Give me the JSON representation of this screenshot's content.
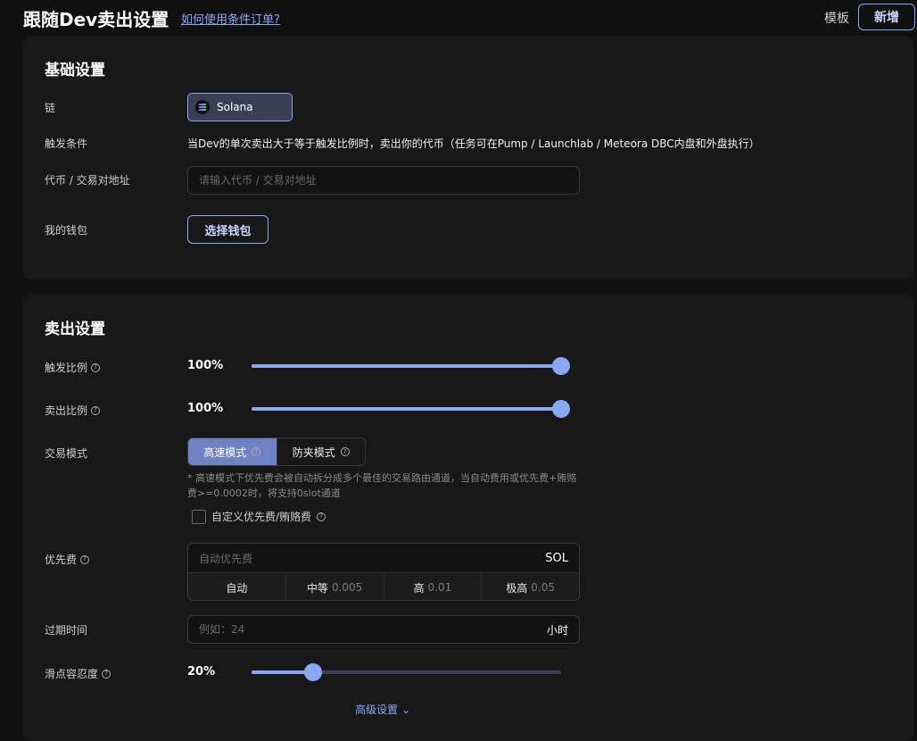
{
  "header": {
    "title": "跟随Dev卖出设置",
    "help_link": "如何使用条件订单?",
    "template_label": "模板",
    "add_label": "新增"
  },
  "basic": {
    "title": "基础设置",
    "chain_label": "链",
    "chain_value": "Solana",
    "trigger_label": "触发条件",
    "trigger_text": "当Dev的单次卖出大于等于触发比例时，卖出你的代币（任务可在Pump / Launchlab / Meteora DBC内盘和外盘执行）",
    "token_label": "代币 / 交易对地址",
    "token_placeholder": "请输入代币 / 交易对地址",
    "wallet_label": "我的钱包",
    "wallet_button": "选择钱包"
  },
  "sell": {
    "title": "卖出设置",
    "trigger_ratio_label": "触发比例",
    "trigger_ratio_text": "100%",
    "trigger_ratio": 100,
    "sell_ratio_label": "卖出比例",
    "sell_ratio_text": "100%",
    "sell_ratio": 100,
    "mode_label": "交易模式",
    "modes": [
      "高速模式",
      "防夹模式"
    ],
    "mode_note": "* 高速模式下优先费会被自动拆分成多个最佳的交易路由通道，当自动费用或优先费+贿赂费>=0.0002时，将支持0slot通道",
    "custom_fee_label": "自定义优先费/贿赂费",
    "priority_label": "优先费",
    "priority_placeholder": "自动优先费",
    "priority_unit": "SOL",
    "fee_options": [
      {
        "label": "自动",
        "value": ""
      },
      {
        "label": "中等",
        "value": "0.005"
      },
      {
        "label": "高",
        "value": "0.01"
      },
      {
        "label": "极高",
        "value": "0.05"
      }
    ],
    "expire_label": "过期时间",
    "expire_placeholder": "例如：24",
    "expire_unit": "小时",
    "slippage_label": "滑点容忍度",
    "slippage_text": "20%",
    "slippage": 20,
    "advanced_label": "高级设置"
  },
  "colors": {
    "accent": "#8aa7f7",
    "background": "#101010",
    "card": "#181818"
  }
}
